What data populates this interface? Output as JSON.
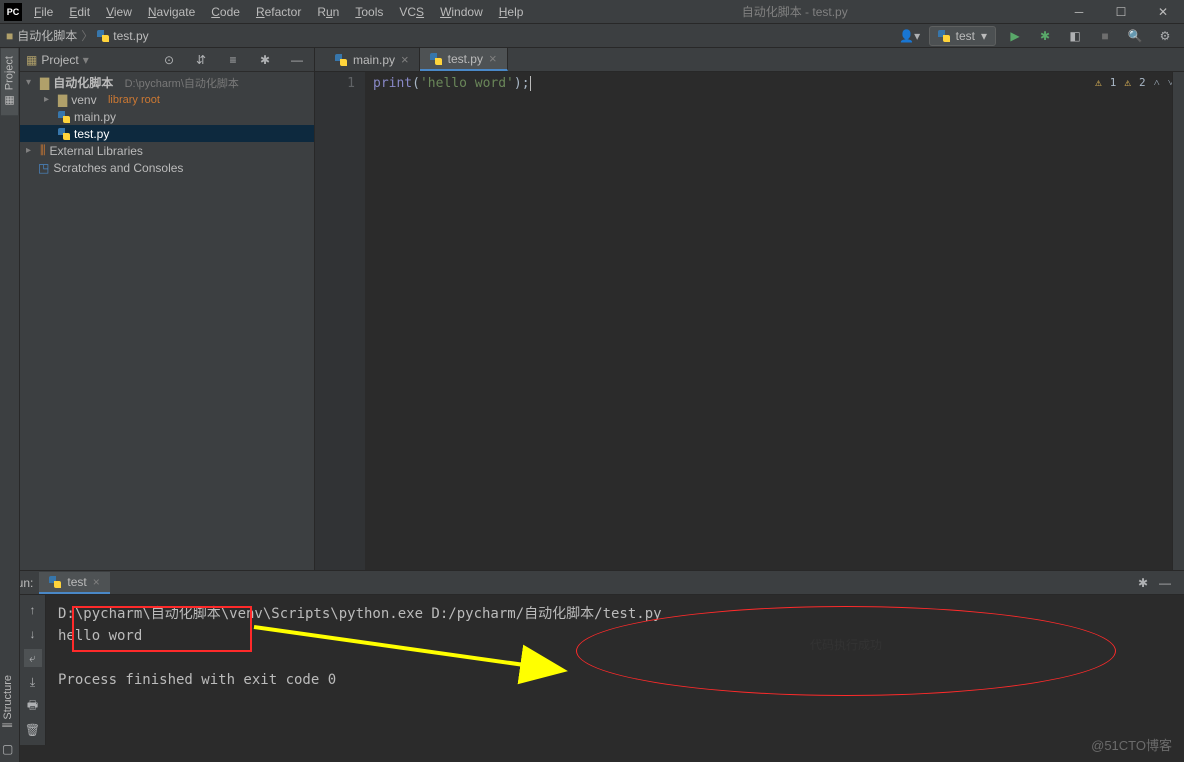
{
  "title": "自动化脚本 - test.py",
  "menus": [
    "File",
    "Edit",
    "View",
    "Navigate",
    "Code",
    "Refactor",
    "Run",
    "Tools",
    "VCS",
    "Window",
    "Help"
  ],
  "breadcrumbs": [
    {
      "label": "自动化脚本",
      "icon": "folder"
    },
    {
      "label": "test.py",
      "icon": "python"
    }
  ],
  "run_config": {
    "label": "test"
  },
  "project_panel": {
    "title": "Project",
    "root": {
      "name": "自动化脚本",
      "path": "D:\\pycharm\\自动化脚本"
    },
    "venv": {
      "name": "venv",
      "tag": "library root"
    },
    "files": [
      "main.py",
      "test.py"
    ],
    "ext_libs": "External Libraries",
    "scratches": "Scratches and Consoles"
  },
  "editor_tabs": [
    {
      "label": "main.py",
      "active": false
    },
    {
      "label": "test.py",
      "active": true
    }
  ],
  "code": {
    "line_no": "1",
    "fn": "print",
    "paren_open": "(",
    "str": "'hello word'",
    "paren_close": ")",
    "semi": ";"
  },
  "inspections": {
    "warn1": "1",
    "warn2": "2"
  },
  "run_tool": {
    "label": "Run:",
    "tab": "test",
    "cmd": "D:\\pycharm\\自动化脚本\\venv\\Scripts\\python.exe D:/pycharm/自动化脚本/test.py",
    "out": "hello word",
    "exit": "Process finished with exit code 0"
  },
  "annotation": {
    "callout": "代码执行成功"
  },
  "watermark": "@51CTO博客",
  "left_tabs": {
    "project": "Project",
    "structure": "Structure"
  }
}
